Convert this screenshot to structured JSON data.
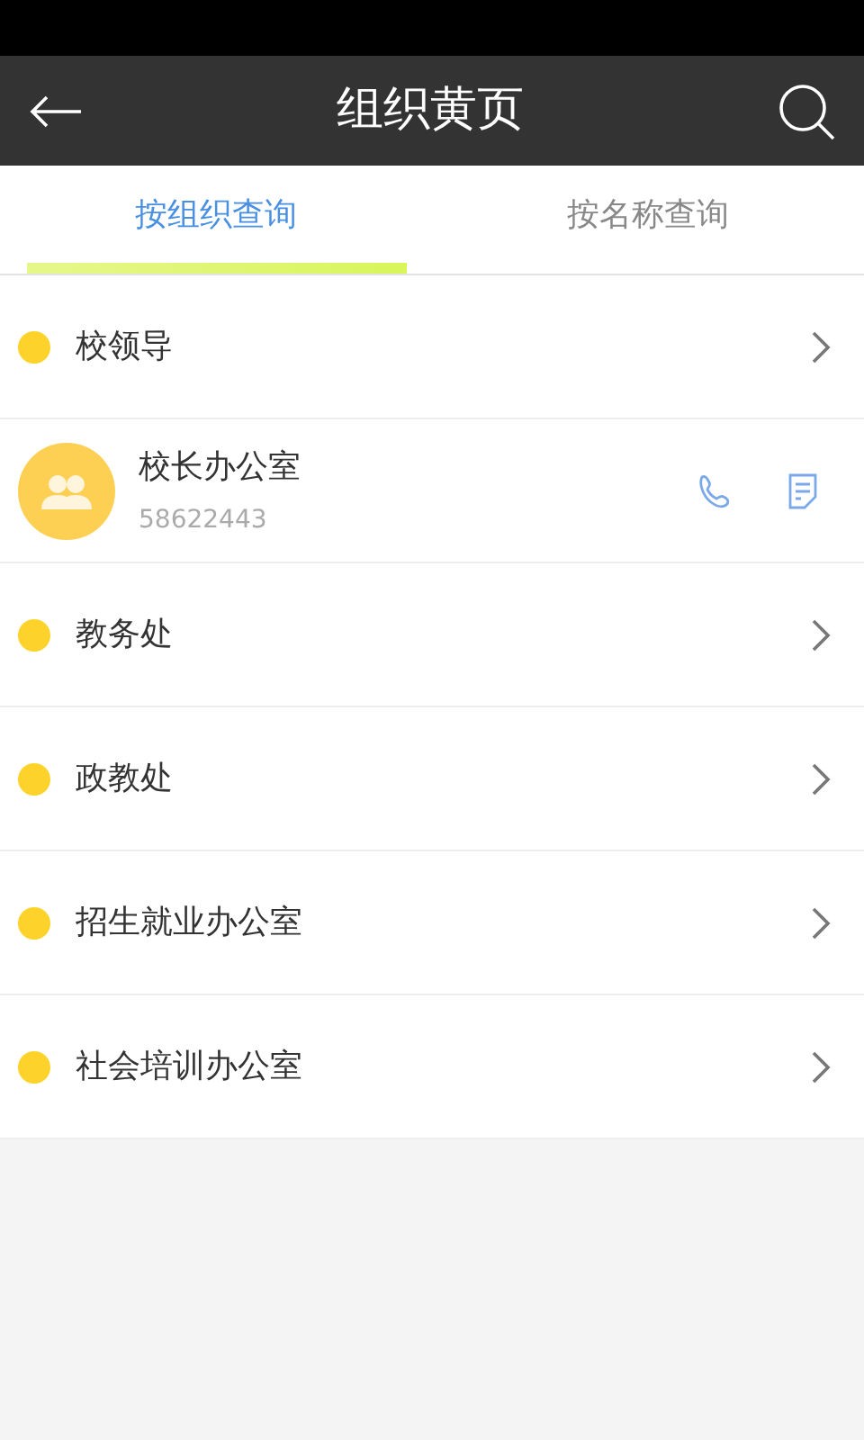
{
  "header": {
    "title": "组织黄页"
  },
  "tabs": [
    {
      "label": "按组织查询",
      "selected": true
    },
    {
      "label": "按名称查询",
      "selected": false
    }
  ],
  "items": [
    {
      "kind": "group",
      "name": "校领导"
    },
    {
      "kind": "contact",
      "name": "校长办公室",
      "phone": "58622443"
    },
    {
      "kind": "group",
      "name": "教务处"
    },
    {
      "kind": "group",
      "name": "政教处"
    },
    {
      "kind": "group",
      "name": "招生就业办公室"
    },
    {
      "kind": "group",
      "name": "社会培训办公室"
    }
  ]
}
